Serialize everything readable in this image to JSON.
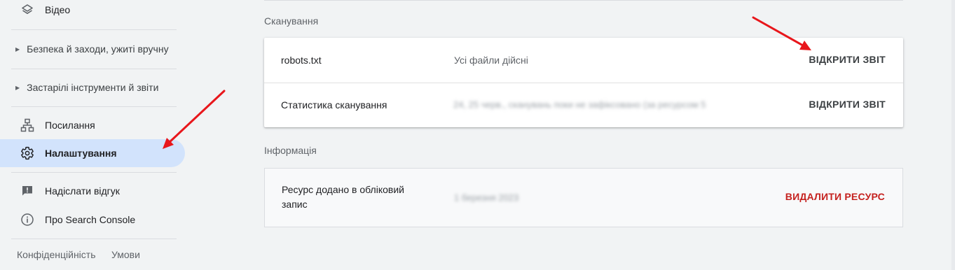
{
  "sidebar": {
    "video": "Відео",
    "security": "Безпека й заходи, ужиті вручну",
    "legacy": "Застарілі інструменти й звіти",
    "links": "Посилання",
    "settings": "Налаштування",
    "feedback": "Надіслати відгук",
    "about": "Про Search Console",
    "privacy": "Конфіденційність",
    "terms": "Умови"
  },
  "crawling": {
    "title": "Сканування",
    "rows": [
      {
        "label": "robots.txt",
        "status": "Усі файли дійсні",
        "action": "ВІДКРИТИ ЗВІТ"
      },
      {
        "label": "Статистика сканування",
        "status": "24, 25 черв., сканувань поки не зафіксовано (за ресурсом 51 днів)",
        "action": "ВІДКРИТИ ЗВІТ"
      }
    ]
  },
  "info": {
    "title": "Інформація",
    "label": "Ресурс додано в обліковий запис",
    "value": "1 березня 2023",
    "action": "ВИДАЛИТИ РЕСУРС"
  },
  "colors": {
    "accent_active": "#d2e3fc",
    "danger": "#c5221f",
    "annotation_arrow": "#e8161b"
  }
}
